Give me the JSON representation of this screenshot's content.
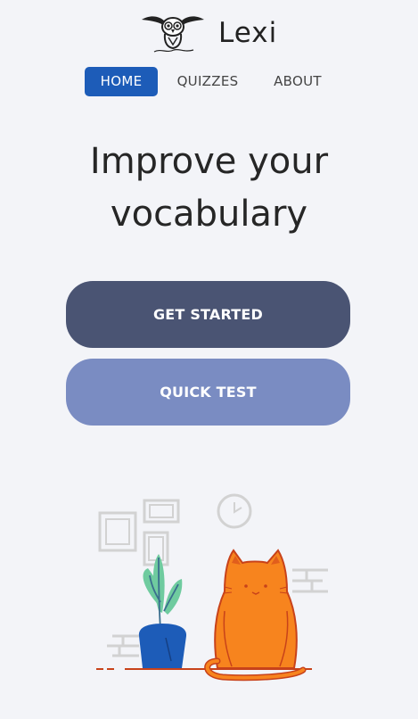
{
  "brand": {
    "name": "Lexi",
    "logo_icon": "owl-logo-icon"
  },
  "nav": {
    "items": [
      {
        "label": "HOME",
        "active": true
      },
      {
        "label": "QUIZZES",
        "active": false
      },
      {
        "label": "ABOUT",
        "active": false
      }
    ]
  },
  "hero": {
    "headline_line1": "Improve your",
    "headline_line2": "vocabulary"
  },
  "actions": {
    "get_started_label": "GET STARTED",
    "quick_test_label": "QUICK TEST"
  },
  "illustration": {
    "icon": "cat-and-plant-illustration",
    "colors": {
      "cat": "#f7841e",
      "cat_outline": "#c8421a",
      "plant": "#6fcb9f",
      "pot": "#1d5cb8",
      "floor": "#c8421a"
    }
  },
  "colors": {
    "accent": "#1d5cb8",
    "primary_button": "#4a5473",
    "secondary_button": "#7a8cc2",
    "background": "#f3f4f8"
  }
}
